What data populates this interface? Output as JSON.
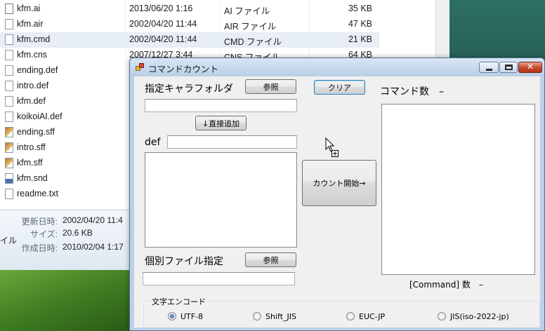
{
  "explorer": {
    "files": [
      {
        "name": "kfm.ai",
        "date": "2013/06/20 1:16",
        "type": "AI ファイル",
        "size": "35 KB",
        "icon": "ai-file-icon"
      },
      {
        "name": "kfm.air",
        "date": "2002/04/20 11:44",
        "type": "AIR ファイル",
        "size": "47 KB",
        "icon": "document-icon"
      },
      {
        "name": "kfm.cmd",
        "date": "2002/04/20 11:44",
        "type": "CMD ファイル",
        "size": "21 KB",
        "icon": "document-icon",
        "selected": true
      },
      {
        "name": "kfm.cns",
        "date": "2007/12/27 3:44",
        "type": "CNS ファイル",
        "size": "64 KB",
        "icon": "document-icon"
      },
      {
        "name": "ending.def",
        "icon": "document-icon"
      },
      {
        "name": "intro.def",
        "icon": "document-icon"
      },
      {
        "name": "kfm.def",
        "icon": "document-icon"
      },
      {
        "name": "koikoiAI.def",
        "icon": "document-icon"
      },
      {
        "name": "ending.sff",
        "icon": "sff-file-icon"
      },
      {
        "name": "intro.sff",
        "icon": "sff-file-icon"
      },
      {
        "name": "kfm.sff",
        "icon": "sff-file-icon"
      },
      {
        "name": "kfm.snd",
        "icon": "snd-file-icon"
      },
      {
        "name": "readme.txt",
        "icon": "text-file-icon"
      }
    ],
    "details": {
      "modified_label": "更新日時:",
      "modified_value": "2002/04/20 11:4",
      "type_fragment": "イル",
      "size_label": "サイズ:",
      "size_value": "20.6 KB",
      "created_label": "作成日時:",
      "created_value": "2010/02/04 1:17"
    }
  },
  "app": {
    "title": "コマンドカウント",
    "caption": {
      "close_glyph": "✕"
    },
    "folder_label": "指定キャラフォルダ",
    "browse_folder_button": "参照",
    "clear_button": "クリア",
    "command_count_label": "コマンド数　–",
    "add_direct_button": "↓直接追加",
    "def_label": "def",
    "start_count_button": "カウント開始→",
    "individual_file_label": "個別ファイル指定",
    "browse_file_button": "参照",
    "command_keyword_count_label": "[Command] 数　–",
    "encoding": {
      "title": "文字エンコード",
      "options": [
        "UTF-8",
        "Shift_JIS",
        "EUC-JP",
        "JIS(iso-2022-jp)"
      ],
      "selected": "UTF-8"
    }
  }
}
